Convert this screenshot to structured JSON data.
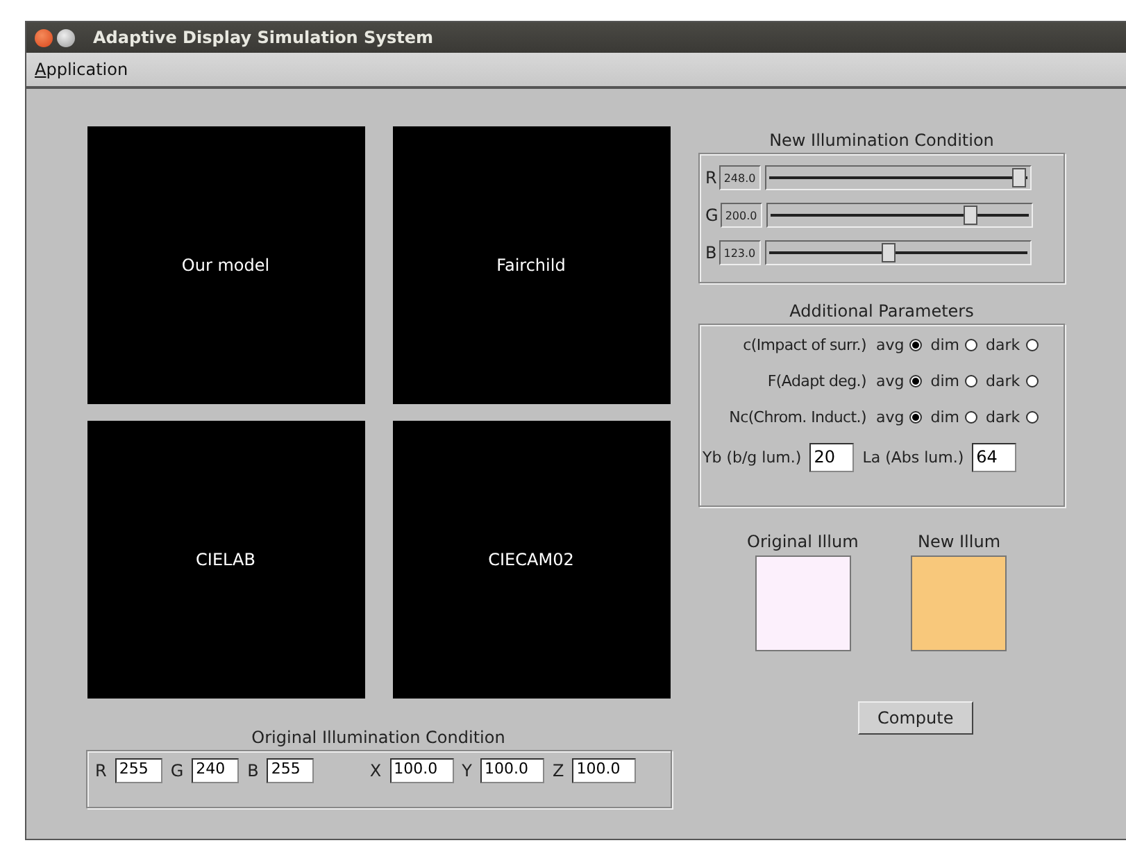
{
  "window": {
    "title": "Adaptive Display Simulation System"
  },
  "menu": [
    {
      "label": "Application"
    }
  ],
  "panels": [
    {
      "label": "Our model"
    },
    {
      "label": "Fairchild"
    },
    {
      "label": "CIELAB"
    },
    {
      "label": "CIECAM02"
    }
  ],
  "new_illumination": {
    "title": "New Illumination Condition",
    "sliders": [
      {
        "label": "R",
        "reading": "248.0",
        "level": 0.97
      },
      {
        "label": "G",
        "reading": "200.0",
        "level": 0.78
      },
      {
        "label": "B",
        "reading": "123.0",
        "level": 0.48
      }
    ]
  },
  "additional_parameters": {
    "title": "Additional Parameters",
    "rows": [
      {
        "label": "c(Impact of surr.)",
        "options": [
          {
            "label": "avg",
            "selected": true
          },
          {
            "label": "dim",
            "selected": false
          },
          {
            "label": "dark",
            "selected": false
          }
        ]
      },
      {
        "label": "F(Adapt deg.)",
        "options": [
          {
            "label": "avg",
            "selected": true
          },
          {
            "label": "dim",
            "selected": false
          },
          {
            "label": "dark",
            "selected": false
          }
        ]
      },
      {
        "label": "Nc(Chrom. Induct.)",
        "options": [
          {
            "label": "avg",
            "selected": true
          },
          {
            "label": "dim",
            "selected": false
          },
          {
            "label": "dark",
            "selected": false
          }
        ]
      }
    ],
    "fields": [
      {
        "label": "Yb (b/g lum.)",
        "value": "20"
      },
      {
        "label": "La (Abs lum.)",
        "value": "64"
      }
    ]
  },
  "swatches": [
    {
      "label": "Original Illum",
      "color": "#fcf0fc"
    },
    {
      "label": "New Illum",
      "color": "#f8c87b"
    }
  ],
  "compute_button": "Compute",
  "original_illumination": {
    "title": "Original Illumination Condition",
    "rgb": [
      {
        "label": "R",
        "value": "255"
      },
      {
        "label": "G",
        "value": "240"
      },
      {
        "label": "B",
        "value": "255"
      }
    ],
    "xyz": [
      {
        "label": "X",
        "value": "100.0"
      },
      {
        "label": "Y",
        "value": "100.0"
      },
      {
        "label": "Z",
        "value": "100.0"
      }
    ]
  }
}
